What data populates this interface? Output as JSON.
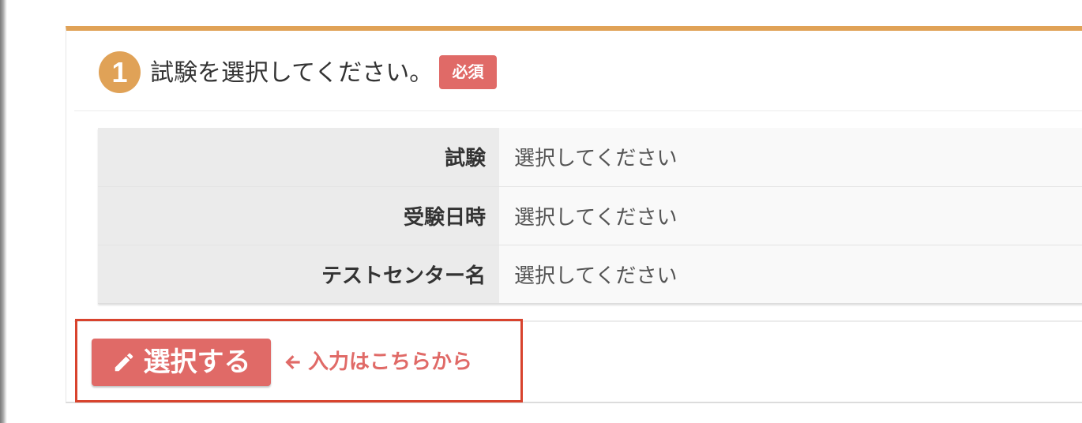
{
  "step": {
    "number": "1",
    "title": "試験を選択してください。",
    "required_label": "必須"
  },
  "selection_table": {
    "rows": [
      {
        "label": "試験",
        "value": "選択してください"
      },
      {
        "label": "受験日時",
        "value": "選択してください"
      },
      {
        "label": "テストセンター名",
        "value": "選択してください"
      }
    ]
  },
  "actions": {
    "select_button_label": "選択する",
    "select_button_icon": "pencil-icon",
    "hint_icon": "arrow-left-icon",
    "hint_text": "入力はこちらから"
  },
  "colors": {
    "accent_orange": "#e0a257",
    "button_red": "#e06a67",
    "highlight_border": "#d8432d",
    "label_bg": "#ebebeb",
    "value_bg": "#f9f9f9"
  }
}
